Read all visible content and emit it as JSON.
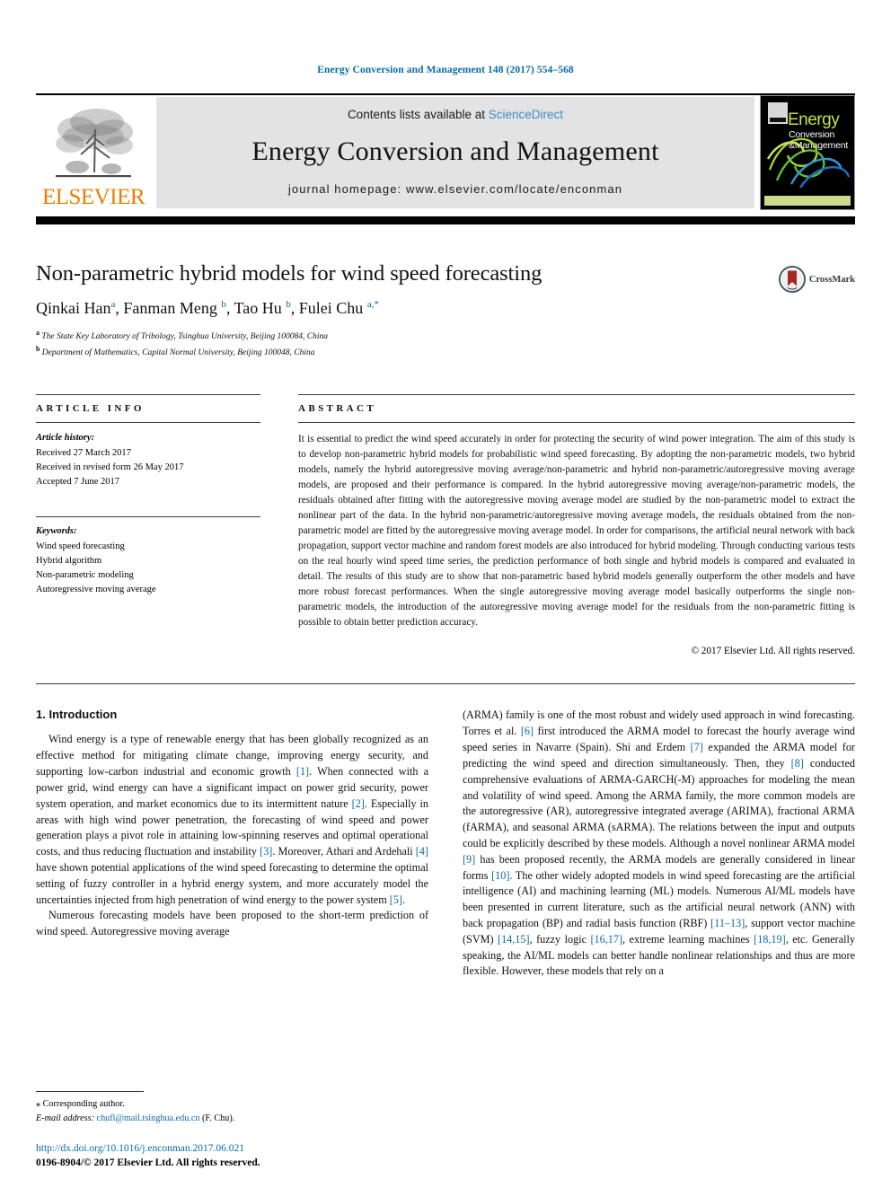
{
  "running_head": "Energy Conversion and Management 148 (2017) 554–568",
  "masthead": {
    "publisher_name": "ELSEVIER",
    "contents_prefix": "Contents lists available at ",
    "sciencedirect": "ScienceDirect",
    "journal_name": "Energy Conversion and Management",
    "homepage": "journal homepage: www.elsevier.com/locate/enconman",
    "cover": {
      "title": "Energy",
      "subtitle_line1": "Conversion",
      "subtitle_line2": "&Management"
    }
  },
  "article": {
    "title": "Non-parametric hybrid models for wind speed forecasting",
    "authors_html": "Qinkai Han<sup>a</sup>, Fanman Meng <sup>b</sup>, Tao Hu <sup>b</sup>, Fulei Chu <sup>a,*</sup>",
    "authors_plain": "Qinkai Han a, Fanman Meng b, Tao Hu b, Fulei Chu a,*",
    "affiliation_a": "The State Key Laboratory of Tribology, Tsinghua University, Beijing 100084, China",
    "affiliation_b": "Department of Mathematics, Capital Normal University, Beijing 100048, China",
    "crossmark_label": "CrossMark"
  },
  "article_info": {
    "heading": "ARTICLE INFO",
    "history_label": "Article history:",
    "history": [
      "Received 27 March 2017",
      "Received in revised form 26 May 2017",
      "Accepted 7 June 2017"
    ],
    "keywords_label": "Keywords:",
    "keywords": [
      "Wind speed forecasting",
      "Hybrid algorithm",
      "Non-parametric modeling",
      "Autoregressive moving average"
    ]
  },
  "abstract": {
    "heading": "ABSTRACT",
    "text": "It is essential to predict the wind speed accurately in order for protecting the security of wind power integration. The aim of this study is to develop non-parametric hybrid models for probabilistic wind speed forecasting. By adopting the non-parametric models, two hybrid models, namely the hybrid autoregressive moving average/non-parametric and hybrid non-parametric/autoregressive moving average models, are proposed and their performance is compared. In the hybrid autoregressive moving average/non-parametric models, the residuals obtained after fitting with the autoregressive moving average model are studied by the non-parametric model to extract the nonlinear part of the data. In the hybrid non-parametric/autoregressive moving average models, the residuals obtained from the non-parametric model are fitted by the autoregressive moving average model. In order for comparisons, the artificial neural network with back propagation, support vector machine and random forest models are also introduced for hybrid modeling. Through conducting various tests on the real hourly wind speed time series, the prediction performance of both single and hybrid models is compared and evaluated in detail. The results of this study are to show that non-parametric based hybrid models generally outperform the other models and have more robust forecast performances. When the single autoregressive moving average model basically outperforms the single non-parametric models, the introduction of the autoregressive moving average model for the residuals from the non-parametric fitting is possible to obtain better prediction accuracy.",
    "copyright": "© 2017 Elsevier Ltd. All rights reserved."
  },
  "introduction": {
    "section_number_title": "1. Introduction",
    "left_para_1_html": "Wind energy is a type of renewable energy that has been globally recognized as an effective method for mitigating climate change, improving energy security, and supporting low-carbon industrial and economic growth <span class=\"ref\">[1]</span>. When connected with a power grid, wind energy can have a significant impact on power grid security, power system operation, and market economics due to its intermittent nature <span class=\"ref\">[2]</span>. Especially in areas with high wind power penetration, the forecasting of wind speed and power generation plays a pivot role in attaining low-spinning reserves and optimal operational costs, and thus reducing fluctuation and instability <span class=\"ref\">[3]</span>. Moreover, Athari and Ardehali <span class=\"ref\">[4]</span> have shown potential applications of the wind speed forecasting to determine the optimal setting of fuzzy controller in a hybrid energy system, and more accurately model the uncertainties injected from high penetration of wind energy to the power system <span class=\"ref\">[5]</span>.",
    "left_para_2_html": "Numerous forecasting models have been proposed to the short-term prediction of wind speed. Autoregressive moving average",
    "right_para_1_html": "(ARMA) family is one of the most robust and widely used approach in wind forecasting. Torres et al. <span class=\"ref\">[6]</span> first introduced the ARMA model to forecast the hourly average wind speed series in Navarre (Spain). Shi and Erdem <span class=\"ref\">[7]</span> expanded the ARMA model for predicting the wind speed and direction simultaneously. Then, they <span class=\"ref\">[8]</span> conducted comprehensive evaluations of ARMA-GARCH(-M) approaches for modeling the mean and volatility of wind speed. Among the ARMA family, the more common models are the autoregressive (AR), autoregressive integrated average (ARIMA), fractional ARMA (fARMA), and seasonal ARMA (sARMA). The relations between the input and outputs could be explicitly described by these models. Although a novel nonlinear ARMA model <span class=\"ref\">[9]</span> has been proposed recently, the ARMA models are generally considered in linear forms <span class=\"ref\">[10]</span>. The other widely adopted models in wind speed forecasting are the artificial intelligence (AI) and machining learning (ML) models. Numerous AI/ML models have been presented in current literature, such as the artificial neural network (ANN) with back propagation (BP) and radial basis function (RBF) <span class=\"ref\">[11–13]</span>, support vector machine (SVM) <span class=\"ref\">[14,15]</span>, fuzzy logic <span class=\"ref\">[16,17]</span>, extreme learning machines <span class=\"ref\">[18,19]</span>, etc. Generally speaking, the AI/ML models can better handle nonlinear relationships and thus are more flexible. However, these models that rely on a"
  },
  "footnote": {
    "corresponding_marker": "⁎",
    "corresponding_text": "Corresponding author.",
    "email_label": "E-mail address:",
    "email": "chufl@mail.tsinghua.edu.cn",
    "email_suffix": "(F. Chu)."
  },
  "footer": {
    "doi": "http://dx.doi.org/10.1016/j.enconman.2017.06.021",
    "issn_line": "0196-8904/© 2017 Elsevier Ltd. All rights reserved."
  },
  "colors": {
    "link_blue": "#0a6ba8",
    "sciencedirect_blue": "#3c8dc5",
    "elsevier_orange": "#ef7d00",
    "band_gray": "#e3e3e3"
  }
}
